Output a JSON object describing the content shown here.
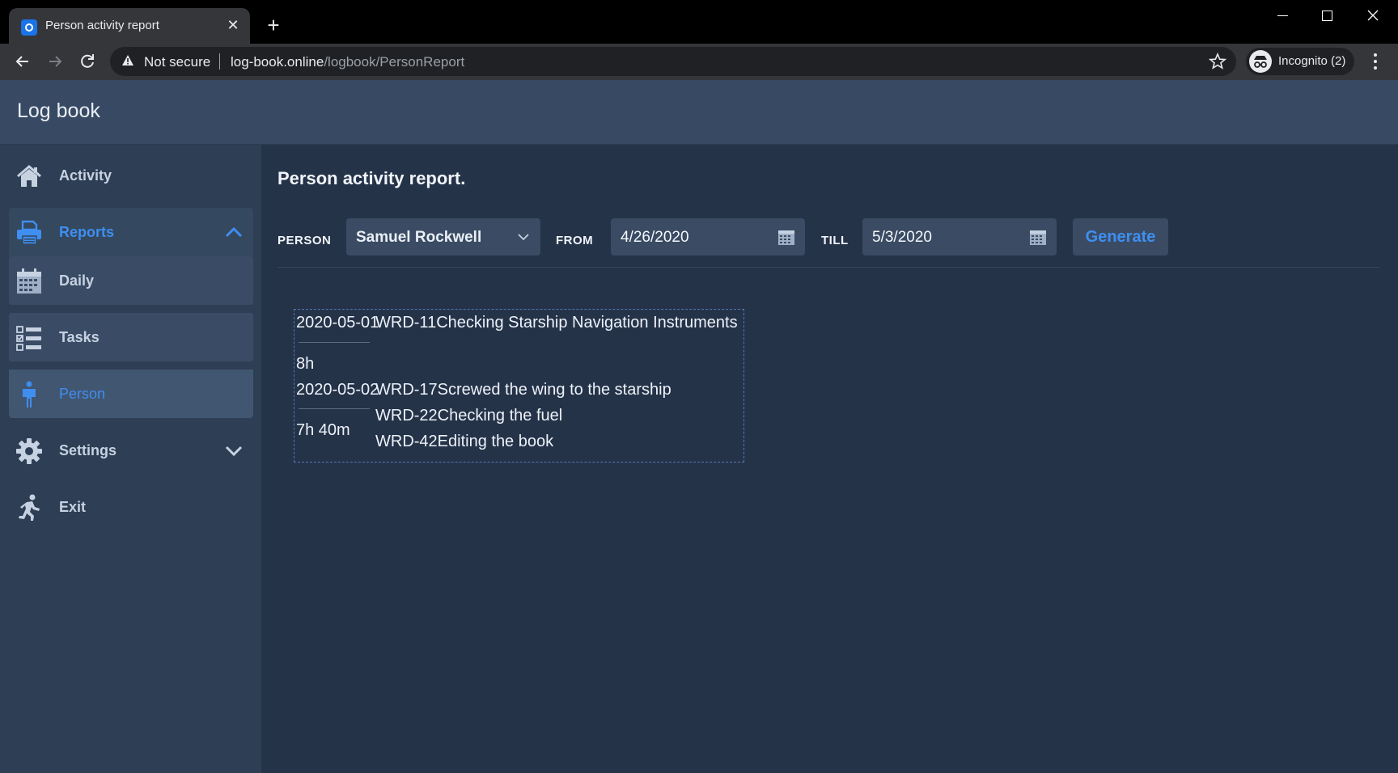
{
  "browser": {
    "tab_title": "Person activity report",
    "security_label": "Not secure",
    "url_host": "log-book.online",
    "url_path": "/logbook/PersonReport",
    "incognito_label": "Incognito (2)"
  },
  "app": {
    "title": "Log book"
  },
  "sidebar": {
    "items": [
      {
        "label": "Activity",
        "icon": "home-icon"
      },
      {
        "label": "Reports",
        "icon": "printer-icon",
        "expanded": true
      },
      {
        "label": "Daily",
        "icon": "calendar-icon"
      },
      {
        "label": "Tasks",
        "icon": "checklist-icon"
      },
      {
        "label": "Person",
        "icon": "person-icon",
        "active": true
      },
      {
        "label": "Settings",
        "icon": "gear-icon"
      },
      {
        "label": "Exit",
        "icon": "running-person-icon"
      }
    ]
  },
  "main": {
    "title": "Person activity report.",
    "filters": {
      "person_label": "PERSON",
      "person_value": "Samuel Rockwell",
      "from_label": "FROM",
      "from_value": "4/26/2020",
      "till_label": "TILL",
      "till_value": "5/3/2020",
      "generate_label": "Generate"
    },
    "report": [
      {
        "date": "2020-05-01",
        "total": "8h",
        "tasks": [
          {
            "id": "WRD-11",
            "title": "Checking Starship Navigation Instruments"
          }
        ]
      },
      {
        "date": "2020-05-02",
        "total": "7h 40m",
        "tasks": [
          {
            "id": "WRD-17",
            "title": "Screwed the wing to the starship"
          },
          {
            "id": "WRD-22",
            "title": "Checking the fuel"
          },
          {
            "id": "WRD-42",
            "title": "Editing the book"
          }
        ]
      }
    ]
  },
  "colors": {
    "accent": "#3f8ef0",
    "background": "#253349",
    "header": "#384a63",
    "sidebar": "#2e3e55"
  }
}
